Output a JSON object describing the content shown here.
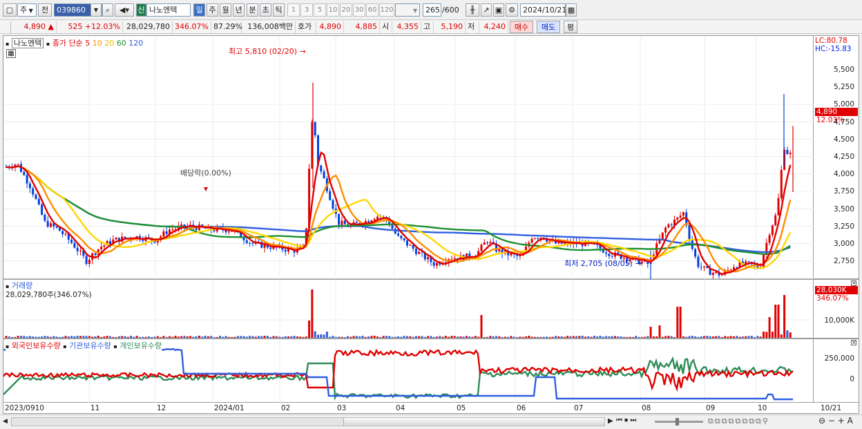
{
  "toolbar": {
    "market_select": "주",
    "prev_label": "전",
    "stock_code": "039860",
    "stock_name": "나노엔텍",
    "badge": "신",
    "periods": [
      "일",
      "주",
      "월",
      "년",
      "분",
      "초",
      "틱"
    ],
    "intervals": [
      "1",
      "3",
      "5",
      "10",
      "20",
      "30",
      "60",
      "120"
    ],
    "count": "265",
    "count_max": "/600",
    "date": "2024/10/21"
  },
  "quote": {
    "price": "4,890",
    "arrow": "▲",
    "change": "525",
    "change_pct": "+12.03%",
    "volume": "28,029,780",
    "volume_pct": "346.07%",
    "rotation": "87.29%",
    "amount": "136,008백만",
    "bid_label": "호가",
    "bid1": "4,890",
    "bid2": "4,885",
    "open_label": "시",
    "open": "4,355",
    "high_label": "고",
    "high": "5,190",
    "low_label": "저",
    "low": "4,240",
    "buy": "매수",
    "sell": "매도",
    "eval": "평"
  },
  "price_panel": {
    "stock_tag": "나노엔텍",
    "ma_title": "종가 단순",
    "ma_periods": [
      "5",
      "10",
      "20",
      "60",
      "120"
    ],
    "ma_colors": [
      "#e00000",
      "#ff8c00",
      "#ffd700",
      "#1e9030",
      "#2e5ee0"
    ],
    "lc": "LC:80.78",
    "hc": "HC:-15.83",
    "y_ticks": [
      "5,500",
      "5,250",
      "5,000",
      "4,750",
      "4,500",
      "4,250",
      "4,000",
      "3,750",
      "3,500",
      "3,250",
      "3,000",
      "2,750"
    ],
    "current_price": "4,890",
    "current_pct": "12.03%",
    "high_note": "최고 5,810 (02/20)",
    "low_note": "최저 2,705 (08/05)",
    "dividend_note": "배당락(0.00%)"
  },
  "volume_panel": {
    "title": "거래량",
    "current": "28,029,780주(346.07%)",
    "tag": "28,030K",
    "tag_pct": "346.07%",
    "y_ticks": [
      "10,000K"
    ]
  },
  "holding_panel": {
    "legend": [
      "외국인보유수량",
      "기관보유수량",
      "개인보유수량"
    ],
    "legend_colors": [
      "#e00000",
      "#2e5ee0",
      "#2e8b57"
    ],
    "y_ticks": [
      "250,000",
      "0"
    ]
  },
  "x_axis": [
    "2023/09",
    "10",
    "11",
    "12",
    "2024/01",
    "02",
    "03",
    "04",
    "05",
    "06",
    "07",
    "08",
    "09",
    "10"
  ],
  "x_axis_right": "10/21",
  "chart_data": {
    "type": "candlestick",
    "y_range": [
      2705,
      5810
    ],
    "high": {
      "value": 5810,
      "date": "02/20"
    },
    "low": {
      "value": 2705,
      "date": "08/05"
    },
    "last": {
      "close": 4890,
      "open": 4355,
      "high": 5190,
      "low": 4240,
      "volume": 28029780
    }
  }
}
